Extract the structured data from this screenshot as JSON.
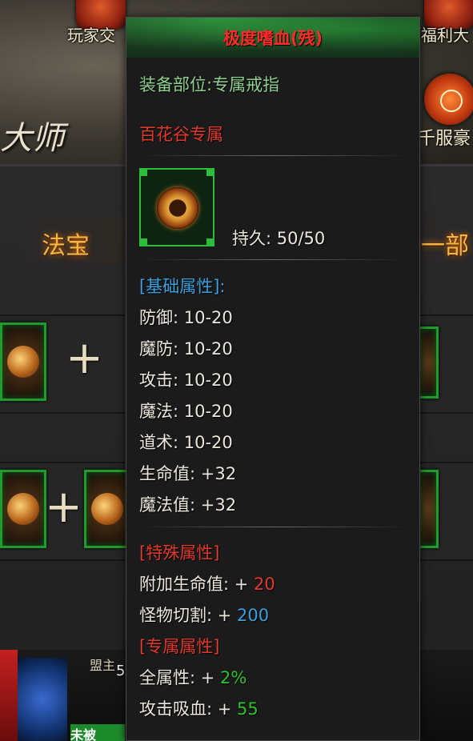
{
  "background": {
    "top_left_label": "玩家交",
    "top_right_label": "福利大",
    "master_text": "大师",
    "right_label": "千服豪",
    "banner_left": "法宝",
    "banner_right": "一部",
    "bottom_label": "盟主",
    "bottom_number": "5",
    "bottom_tag": "未被"
  },
  "tooltip": {
    "title": "极度嗜血(残)",
    "slot_line": "装备部位:专属戒指",
    "exclusive_line": "百花谷专属",
    "durability": "持久:  50/50",
    "base_header": "[基础属性]:",
    "base_stats": [
      "防御:  10-20",
      "魔防:  10-20",
      "攻击:  10-20",
      "魔法:  10-20",
      "道术:  10-20",
      "生命值:  +32",
      "魔法值:  +32"
    ],
    "special_header": "[特殊属性]",
    "special_stats": [
      {
        "label": "附加生命值: + ",
        "value": "20"
      },
      {
        "label": "怪物切割: + ",
        "value": "200"
      }
    ],
    "exclusive_header": "[专属属性]",
    "exclusive_stats": [
      {
        "label": "全属性: + ",
        "value": "2%"
      },
      {
        "label": "攻击吸血: + ",
        "value": "55"
      }
    ]
  },
  "colors": {
    "title": "#ff2a2a",
    "slot_text": "#8ed18e",
    "header_blue": "#3aa0e0",
    "header_red": "#e23a2a",
    "value_green": "#2ec22e",
    "frame_green": "#2bbd3c"
  }
}
